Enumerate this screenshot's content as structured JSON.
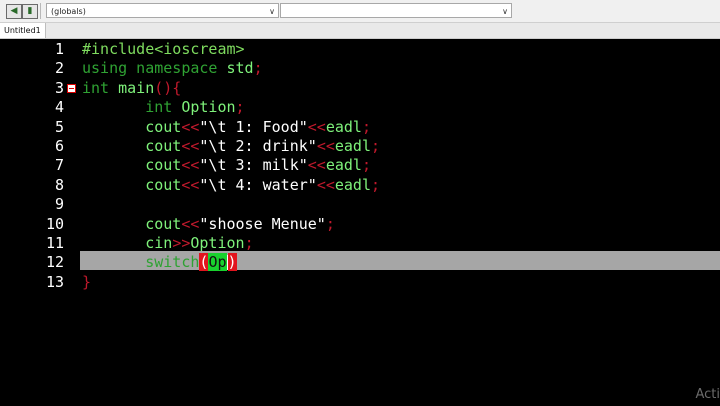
{
  "toolbar": {
    "globals_combo": "(globals)",
    "second_combo": ""
  },
  "tab": {
    "label": "Untitled1"
  },
  "editor": {
    "lines": [
      {
        "num": "1",
        "tokens": [
          [
            "pp",
            "#include<ioscream>"
          ]
        ]
      },
      {
        "num": "2",
        "tokens": [
          [
            "kw",
            "using namespace "
          ],
          [
            "id",
            "std"
          ],
          [
            "op",
            ";"
          ]
        ]
      },
      {
        "num": "3",
        "fold": true,
        "tokens": [
          [
            "kw",
            "int "
          ],
          [
            "id",
            "main"
          ],
          [
            "op",
            "(){"
          ]
        ]
      },
      {
        "num": "4",
        "tokens": [
          [
            "st",
            "\t"
          ],
          [
            "kw",
            "int "
          ],
          [
            "id",
            "Option"
          ],
          [
            "op",
            ";"
          ]
        ]
      },
      {
        "num": "5",
        "tokens": [
          [
            "st",
            "\t"
          ],
          [
            "id",
            "cout"
          ],
          [
            "op",
            "<<"
          ],
          [
            "st",
            "\"\\t 1: Food\""
          ],
          [
            "op",
            "<<"
          ],
          [
            "id",
            "eadl"
          ],
          [
            "op",
            ";"
          ]
        ]
      },
      {
        "num": "6",
        "tokens": [
          [
            "st",
            "\t"
          ],
          [
            "id",
            "cout"
          ],
          [
            "op",
            "<<"
          ],
          [
            "st",
            "\"\\t 2: drink\""
          ],
          [
            "op",
            "<<"
          ],
          [
            "id",
            "eadl"
          ],
          [
            "op",
            ";"
          ]
        ]
      },
      {
        "num": "7",
        "tokens": [
          [
            "st",
            "\t"
          ],
          [
            "id",
            "cout"
          ],
          [
            "op",
            "<<"
          ],
          [
            "st",
            "\"\\t 3: milk\""
          ],
          [
            "op",
            "<<"
          ],
          [
            "id",
            "eadl"
          ],
          [
            "op",
            ";"
          ]
        ]
      },
      {
        "num": "8",
        "tokens": [
          [
            "st",
            "\t"
          ],
          [
            "id",
            "cout"
          ],
          [
            "op",
            "<<"
          ],
          [
            "st",
            "\"\\t 4: water\""
          ],
          [
            "op",
            "<<"
          ],
          [
            "id",
            "eadl"
          ],
          [
            "op",
            ";"
          ]
        ]
      },
      {
        "num": "9",
        "tokens": []
      },
      {
        "num": "10",
        "tokens": [
          [
            "st",
            "\t"
          ],
          [
            "id",
            "cout"
          ],
          [
            "op",
            "<<"
          ],
          [
            "st",
            "\"shoose Menue\""
          ],
          [
            "op",
            ";"
          ]
        ]
      },
      {
        "num": "11",
        "tokens": [
          [
            "st",
            "\t"
          ],
          [
            "id",
            "cin"
          ],
          [
            "op",
            ">>"
          ],
          [
            "id",
            "Option"
          ],
          [
            "op",
            ";"
          ]
        ]
      },
      {
        "num": "12",
        "current": true,
        "tokens": [
          [
            "st",
            "\t"
          ],
          [
            "kw",
            "switch"
          ],
          [
            "selr",
            "("
          ],
          [
            "selg",
            "Op"
          ],
          [
            "cur",
            ""
          ],
          [
            "selr",
            ")"
          ]
        ]
      },
      {
        "num": "13",
        "tokens": [
          [
            "br",
            "}"
          ]
        ]
      }
    ]
  },
  "watermark": "Acti",
  "colors": {
    "editor_bg": "#000000",
    "keyword": "#2fa233",
    "identifier": "#7ff27b",
    "operator": "#c0192c",
    "string": "#ffffff",
    "current_line": "#a6a6a6"
  }
}
